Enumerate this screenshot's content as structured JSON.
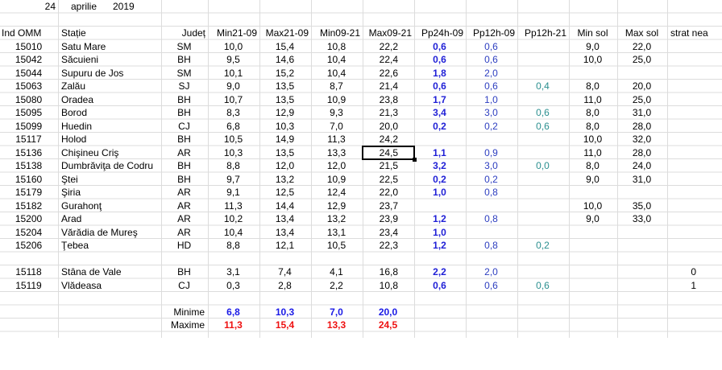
{
  "date": {
    "day": "24",
    "month": "aprilie",
    "year": "2019"
  },
  "headers": [
    "Ind OMM",
    "Stație",
    "Județ",
    "Min21-09",
    "Max21-09",
    "Min09-21",
    "Max09-21",
    "Pp24h-09",
    "Pp12h-09",
    "Pp12h-21",
    "Min sol",
    "Max sol",
    "strat nea"
  ],
  "rows": [
    {
      "id": "15010",
      "name": "Satu Mare",
      "judet": "SM",
      "min2109": "10,0",
      "max2109": "15,4",
      "min0921": "10,8",
      "max0921": "22,2",
      "pp24": "0,6",
      "pp12a": "0,6",
      "pp12b": "",
      "minsol": "9,0",
      "maxsol": "22,0",
      "nea": ""
    },
    {
      "id": "15042",
      "name": "Săcuieni",
      "judet": "BH",
      "min2109": "9,5",
      "max2109": "14,6",
      "min0921": "10,4",
      "max0921": "22,4",
      "pp24": "0,6",
      "pp12a": "0,6",
      "pp12b": "",
      "minsol": "10,0",
      "maxsol": "25,0",
      "nea": ""
    },
    {
      "id": "15044",
      "name": "Supuru de Jos",
      "judet": "SM",
      "min2109": "10,1",
      "max2109": "15,2",
      "min0921": "10,4",
      "max0921": "22,6",
      "pp24": "1,8",
      "pp12a": "2,0",
      "pp12b": "",
      "minsol": "",
      "maxsol": "",
      "nea": ""
    },
    {
      "id": "15063",
      "name": "Zalău",
      "judet": "SJ",
      "min2109": "9,0",
      "max2109": "13,5",
      "min0921": "8,7",
      "max0921": "21,4",
      "pp24": "0,6",
      "pp12a": "0,6",
      "pp12b": "0,4",
      "minsol": "8,0",
      "maxsol": "20,0",
      "nea": ""
    },
    {
      "id": "15080",
      "name": "Oradea",
      "judet": "BH",
      "min2109": "10,7",
      "max2109": "13,5",
      "min0921": "10,9",
      "max0921": "23,8",
      "pp24": "1,7",
      "pp12a": "1,0",
      "pp12b": "",
      "minsol": "11,0",
      "maxsol": "25,0",
      "nea": ""
    },
    {
      "id": "15095",
      "name": "Borod",
      "judet": "BH",
      "min2109": "8,3",
      "max2109": "12,9",
      "min0921": "9,3",
      "max0921": "21,3",
      "pp24": "3,4",
      "pp12a": "3,0",
      "pp12b": "0,6",
      "minsol": "8,0",
      "maxsol": "31,0",
      "nea": ""
    },
    {
      "id": "15099",
      "name": "Huedin",
      "judet": "CJ",
      "min2109": "6,8",
      "max2109": "10,3",
      "min0921": "7,0",
      "max0921": "20,0",
      "pp24": "0,2",
      "pp12a": "0,2",
      "pp12b": "0,6",
      "minsol": "8,0",
      "maxsol": "28,0",
      "nea": ""
    },
    {
      "id": "15117",
      "name": "Holod",
      "judet": "BH",
      "min2109": "10,5",
      "max2109": "14,9",
      "min0921": "11,3",
      "max0921": "24,2",
      "pp24": "",
      "pp12a": "",
      "pp12b": "",
      "minsol": "10,0",
      "maxsol": "32,0",
      "nea": ""
    },
    {
      "id": "15136",
      "name": "Chişineu      Criş",
      "judet": "AR",
      "min2109": "10,3",
      "max2109": "13,5",
      "min0921": "13,3",
      "max0921": "24,5",
      "pp24": "1,1",
      "pp12a": "0,9",
      "pp12b": "",
      "minsol": "11,0",
      "maxsol": "28,0",
      "nea": ""
    },
    {
      "id": "15138",
      "name": "Dumbrăviţa de Codru",
      "judet": "BH",
      "min2109": "8,8",
      "max2109": "12,0",
      "min0921": "12,0",
      "max0921": "21,5",
      "pp24": "3,2",
      "pp12a": "3,0",
      "pp12b": "0,0",
      "minsol": "8,0",
      "maxsol": "24,0",
      "nea": ""
    },
    {
      "id": "15160",
      "name": "Ştei",
      "judet": "BH",
      "min2109": "9,7",
      "max2109": "13,2",
      "min0921": "10,9",
      "max0921": "22,5",
      "pp24": "0,2",
      "pp12a": "0,2",
      "pp12b": "",
      "minsol": "9,0",
      "maxsol": "31,0",
      "nea": ""
    },
    {
      "id": "15179",
      "name": "Şiria",
      "judet": "AR",
      "min2109": "9,1",
      "max2109": "12,5",
      "min0921": "12,4",
      "max0921": "22,0",
      "pp24": "1,0",
      "pp12a": "0,8",
      "pp12b": "",
      "minsol": "",
      "maxsol": "",
      "nea": ""
    },
    {
      "id": "15182",
      "name": "Gurahonţ",
      "judet": "AR",
      "min2109": "11,3",
      "max2109": "14,4",
      "min0921": "12,9",
      "max0921": "23,7",
      "pp24": "",
      "pp12a": "",
      "pp12b": "",
      "minsol": "10,0",
      "maxsol": "35,0",
      "nea": ""
    },
    {
      "id": "15200",
      "name": "Arad",
      "judet": "AR",
      "min2109": "10,2",
      "max2109": "13,4",
      "min0921": "13,2",
      "max0921": "23,9",
      "pp24": "1,2",
      "pp12a": "0,8",
      "pp12b": "",
      "minsol": "9,0",
      "maxsol": "33,0",
      "nea": ""
    },
    {
      "id": "15204",
      "name": "Vărădia de Mureş",
      "judet": "AR",
      "min2109": "10,4",
      "max2109": "13,4",
      "min0921": "13,1",
      "max0921": "23,4",
      "pp24": "1,0",
      "pp12a": "",
      "pp12b": "",
      "minsol": "",
      "maxsol": "",
      "nea": ""
    },
    {
      "id": "15206",
      "name": "Ţebea",
      "judet": "HD",
      "min2109": "8,8",
      "max2109": "12,1",
      "min0921": "10,5",
      "max0921": "22,3",
      "pp24": "1,2",
      "pp12a": "0,8",
      "pp12b": "0,2",
      "minsol": "",
      "maxsol": "",
      "nea": ""
    },
    null,
    {
      "id": "15118",
      "name": "Stâna de Vale",
      "judet": "BH",
      "min2109": "3,1",
      "max2109": "7,4",
      "min0921": "4,1",
      "max0921": "16,8",
      "pp24": "2,2",
      "pp12a": "2,0",
      "pp12b": "",
      "minsol": "",
      "maxsol": "",
      "nea": "0"
    },
    {
      "id": "15119",
      "name": "Vlădeasa",
      "judet": "CJ",
      "min2109": "0,3",
      "max2109": "2,8",
      "min0921": "2,2",
      "max0921": "10,8",
      "pp24": "0,6",
      "pp12a": "0,6",
      "pp12b": "0,6",
      "minsol": "",
      "maxsol": "",
      "nea": "1"
    }
  ],
  "summary": {
    "min_label": "Minime",
    "max_label": "Maxime",
    "min_values": [
      "6,8",
      "10,3",
      "7,0",
      "20,0"
    ],
    "max_values": [
      "11,3",
      "15,4",
      "13,3",
      "24,5"
    ]
  },
  "selected_cell": "24,5"
}
